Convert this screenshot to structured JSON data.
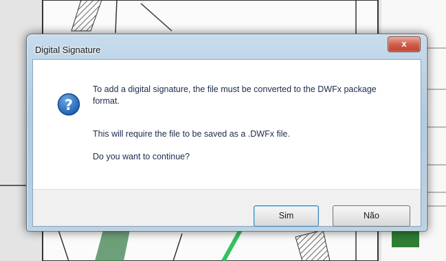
{
  "dialog": {
    "title": "Digital Signature",
    "close_symbol": "x",
    "icon": "question-icon",
    "message_line1": "To add a digital signature, the file must be converted to the DWFx package format.",
    "message_line2": "This will require the file to be saved as a .DWFx file.",
    "message_line3": "Do you want to continue?",
    "buttons": {
      "yes": "Sim",
      "no": "Não"
    }
  },
  "colors": {
    "icon_blue": "#1f5fae",
    "close_red": "#c94a38",
    "frame_blue": "#b9d2e6"
  }
}
